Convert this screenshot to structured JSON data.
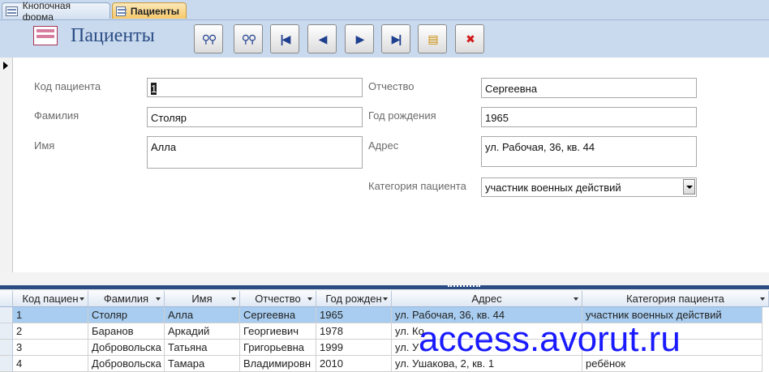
{
  "tabs": [
    {
      "label": "Кнопочная форма",
      "active": false
    },
    {
      "label": "Пациенты",
      "active": true
    }
  ],
  "header": {
    "title": "Пациенты",
    "toolbar": [
      {
        "name": "find-button",
        "icon": "binoculars-icon",
        "glyph": "⚲⚲"
      },
      {
        "name": "find-next-button",
        "icon": "binoculars-next-icon",
        "glyph": "⚲⚲"
      },
      {
        "name": "first-record-button",
        "icon": "first-record-icon",
        "glyph": "|◀"
      },
      {
        "name": "previous-record-button",
        "icon": "previous-record-icon",
        "glyph": "◀"
      },
      {
        "name": "next-record-button",
        "icon": "next-record-icon",
        "glyph": "▶"
      },
      {
        "name": "last-record-button",
        "icon": "last-record-icon",
        "glyph": "▶|"
      },
      {
        "name": "add-record-button",
        "icon": "new-record-icon",
        "glyph": "▤"
      },
      {
        "name": "delete-record-button",
        "icon": "delete-record-icon",
        "glyph": "✖"
      }
    ]
  },
  "form": {
    "patient_id": {
      "label": "Код пациента",
      "value": "1"
    },
    "last_name": {
      "label": "Фамилия",
      "value": "Столяр"
    },
    "first_name": {
      "label": "Имя",
      "value": "Алла"
    },
    "patronymic": {
      "label": "Отчество",
      "value": "Сергеевна"
    },
    "birth_year": {
      "label": "Год рождения",
      "value": "1965"
    },
    "address": {
      "label": "Адрес",
      "value": "ул. Рабочая, 36, кв. 44"
    },
    "category": {
      "label": "Категория пациента",
      "value": "участник военных действий"
    }
  },
  "datasheet": {
    "columns": [
      "Код пациен",
      "Фамилия",
      "Имя",
      "Отчество",
      "Год рожден",
      "Адрес",
      "Категория пациента"
    ],
    "rows": [
      [
        "1",
        "Столяр",
        "Алла",
        "Сергеевна",
        "1965",
        "ул. Рабочая, 36, кв. 44",
        "участник военных действий"
      ],
      [
        "2",
        "Баранов",
        "Аркадий",
        "Георгиевич",
        "1978",
        "ул. Ко",
        ""
      ],
      [
        "3",
        "Добровольска",
        "Татьяна",
        "Григорьевна",
        "1999",
        "ул. У",
        ""
      ],
      [
        "4",
        "Добровольска",
        "Тамара",
        "Владимировн",
        "2010",
        "ул. Ушакова, 2, кв. 1",
        "ребёнок"
      ]
    ],
    "selected_row": 0
  },
  "watermark": "access.avorut.ru",
  "colors": {
    "accent": "#2a4d84",
    "tab_active": "#f6c86a",
    "header_bg": "#c9d9ee",
    "row_selected": "#a8cdf0",
    "watermark": "#1a1aff"
  }
}
